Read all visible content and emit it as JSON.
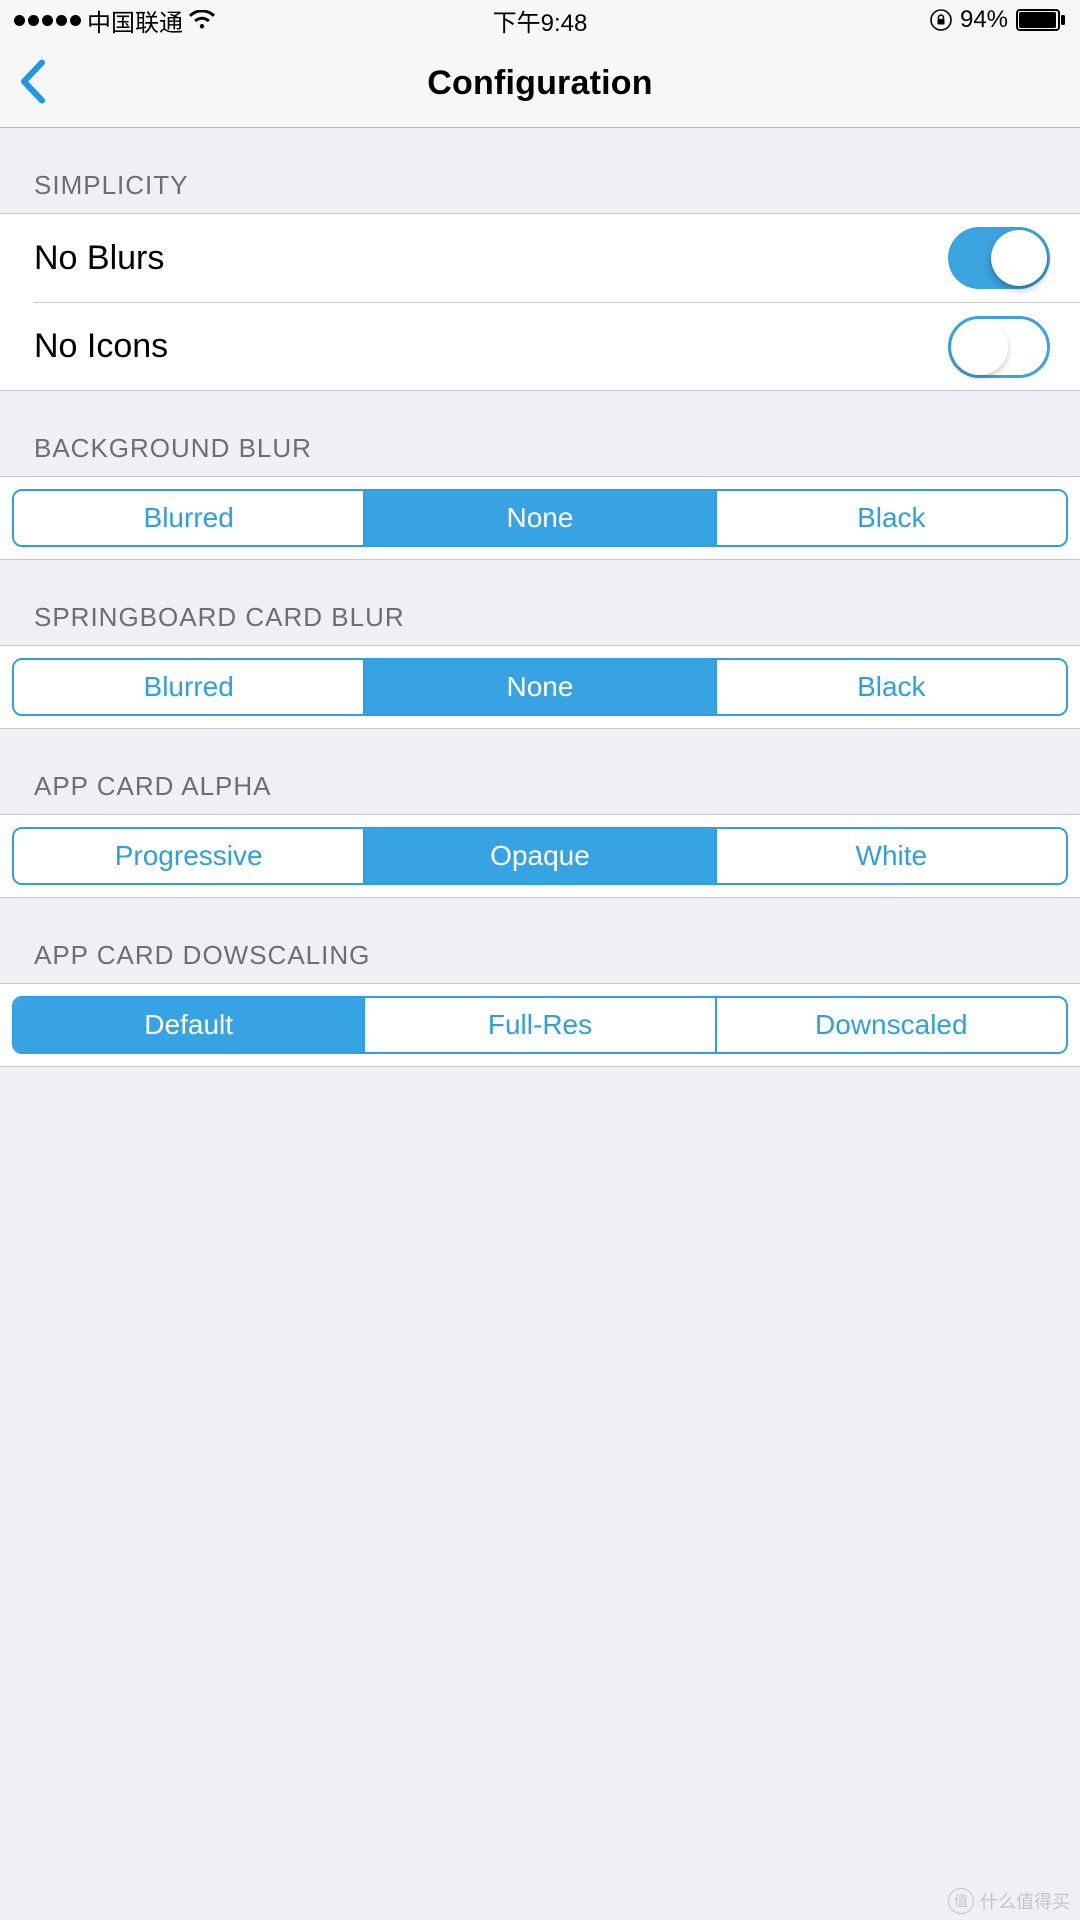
{
  "status": {
    "carrier": "中国联通",
    "time": "下午9:48",
    "battery_pct": "94%"
  },
  "nav": {
    "title": "Configuration"
  },
  "sections": {
    "simplicity": {
      "header": "SIMPLICITY",
      "rows": [
        {
          "label": "No Blurs",
          "on": true
        },
        {
          "label": "No Icons",
          "on": false
        }
      ]
    },
    "background_blur": {
      "header": "BACKGROUND BLUR",
      "options": [
        "Blurred",
        "None",
        "Black"
      ],
      "selected": 1
    },
    "springboard_card_blur": {
      "header": "SPRINGBOARD CARD BLUR",
      "options": [
        "Blurred",
        "None",
        "Black"
      ],
      "selected": 1
    },
    "app_card_alpha": {
      "header": "APP CARD ALPHA",
      "options": [
        "Progressive",
        "Opaque",
        "White"
      ],
      "selected": 1
    },
    "app_card_downscaling": {
      "header": "APP CARD DOWSCALING",
      "options": [
        "Default",
        "Full-Res",
        "Downscaled"
      ],
      "selected": 0
    }
  },
  "watermark": "什么值得买"
}
